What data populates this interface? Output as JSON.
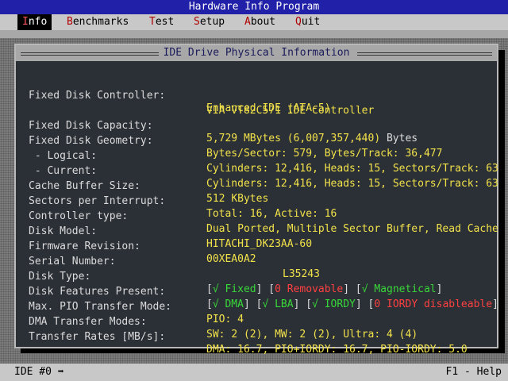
{
  "window": {
    "title": "Hardware Info Program"
  },
  "menu": [
    {
      "hot": "I",
      "rest": "nfo"
    },
    {
      "hot": "B",
      "rest": "enchmarks"
    },
    {
      "hot": "T",
      "rest": "est"
    },
    {
      "hot": "S",
      "rest": "etup"
    },
    {
      "hot": "A",
      "rest": "bout"
    },
    {
      "hot": "Q",
      "rest": "uit"
    }
  ],
  "panel": {
    "title": "IDE Drive Physical Information",
    "rows": [
      {
        "label": "Fixed Disk Controller:",
        "value": "Enhanced IDE (ATA-5)"
      },
      {
        "label": "",
        "value": "VIA VT82C571 IDE Controller"
      },
      {
        "label": "Fixed Disk Capacity:",
        "v1": "5,729 MBytes (6,007,357,440) ",
        "v2": "Bytes"
      },
      {
        "label": "Fixed Disk Geometry:",
        "v1": "Bytes/Sector: ",
        "v2": "579",
        "v3": ", Bytes/Track: ",
        "v4": "36,477"
      },
      {
        "label": " - Logical:",
        "v1": "Cylinders: ",
        "v2": "12,416",
        "v3": ", Heads: ",
        "v4": "15",
        "v5": ", Sectors/Track: ",
        "v6": "63"
      },
      {
        "label": " - Current:",
        "v1": "Cylinders: ",
        "v2": "12,416",
        "v3": ", Heads: ",
        "v4": "15",
        "v5": ", Sectors/Track: ",
        "v6": "63"
      },
      {
        "label": "Cache Buffer Size:",
        "v1": "512 ",
        "v2": "KBytes"
      },
      {
        "label": "Sectors per Interrupt:",
        "v1": "Total: ",
        "v2": "16",
        "v3": ", Active: ",
        "v4": "16"
      },
      {
        "label": "Controller type:",
        "value": "Dual Ported, Multiple Sector Buffer, Read Cache"
      },
      {
        "label": "Disk Model:",
        "value": "HITACHI_DK23AA-60"
      },
      {
        "label": "Firmware Revision:",
        "value": "00XEA0A2"
      },
      {
        "label": "Serial Number:",
        "value": "L35243"
      },
      {
        "label": "Disk Type:"
      },
      {
        "label": "Disk Features Present:"
      },
      {
        "label": "Max. PIO Transfer Mode:",
        "v1": "PIO: ",
        "v2": "4"
      },
      {
        "label": "DMA Transfer Modes:",
        "v1": "SW: ",
        "v2": "2 (2)",
        "v3": ", MW: ",
        "v4": "2 (2)",
        "v5": ", Ultra: ",
        "v6": "4 (4)"
      },
      {
        "label": "Transfer Rates [MB/s]:",
        "v1": "DMA: ",
        "v2": "16.7",
        "v3": ", PIO+IORDY: ",
        "v4": "16.7",
        "v5": ", PIO-IORDY: ",
        "v6": "5.0"
      }
    ],
    "disk_type": [
      {
        "mark": "√",
        "name": "Fixed",
        "state": "yes"
      },
      {
        "mark": "0",
        "name": "Removable",
        "state": "no"
      },
      {
        "mark": "√",
        "name": "Magnetical",
        "state": "yes"
      }
    ],
    "features": [
      {
        "mark": "√",
        "name": "DMA",
        "state": "yes"
      },
      {
        "mark": "√",
        "name": "LBA",
        "state": "yes"
      },
      {
        "mark": "√",
        "name": "IORDY",
        "state": "yes"
      },
      {
        "mark": "0",
        "name": "IORDY disableable",
        "state": "no"
      }
    ]
  },
  "status": {
    "left": "IDE #0 ➡",
    "right": "F1 - Help"
  },
  "colors": {
    "label": "#dcdcdc",
    "value": "#f2e24a",
    "yes": "#38d838",
    "no": "#ff4040",
    "title_bar": "#2020a8",
    "panel": "#2b2f36"
  }
}
